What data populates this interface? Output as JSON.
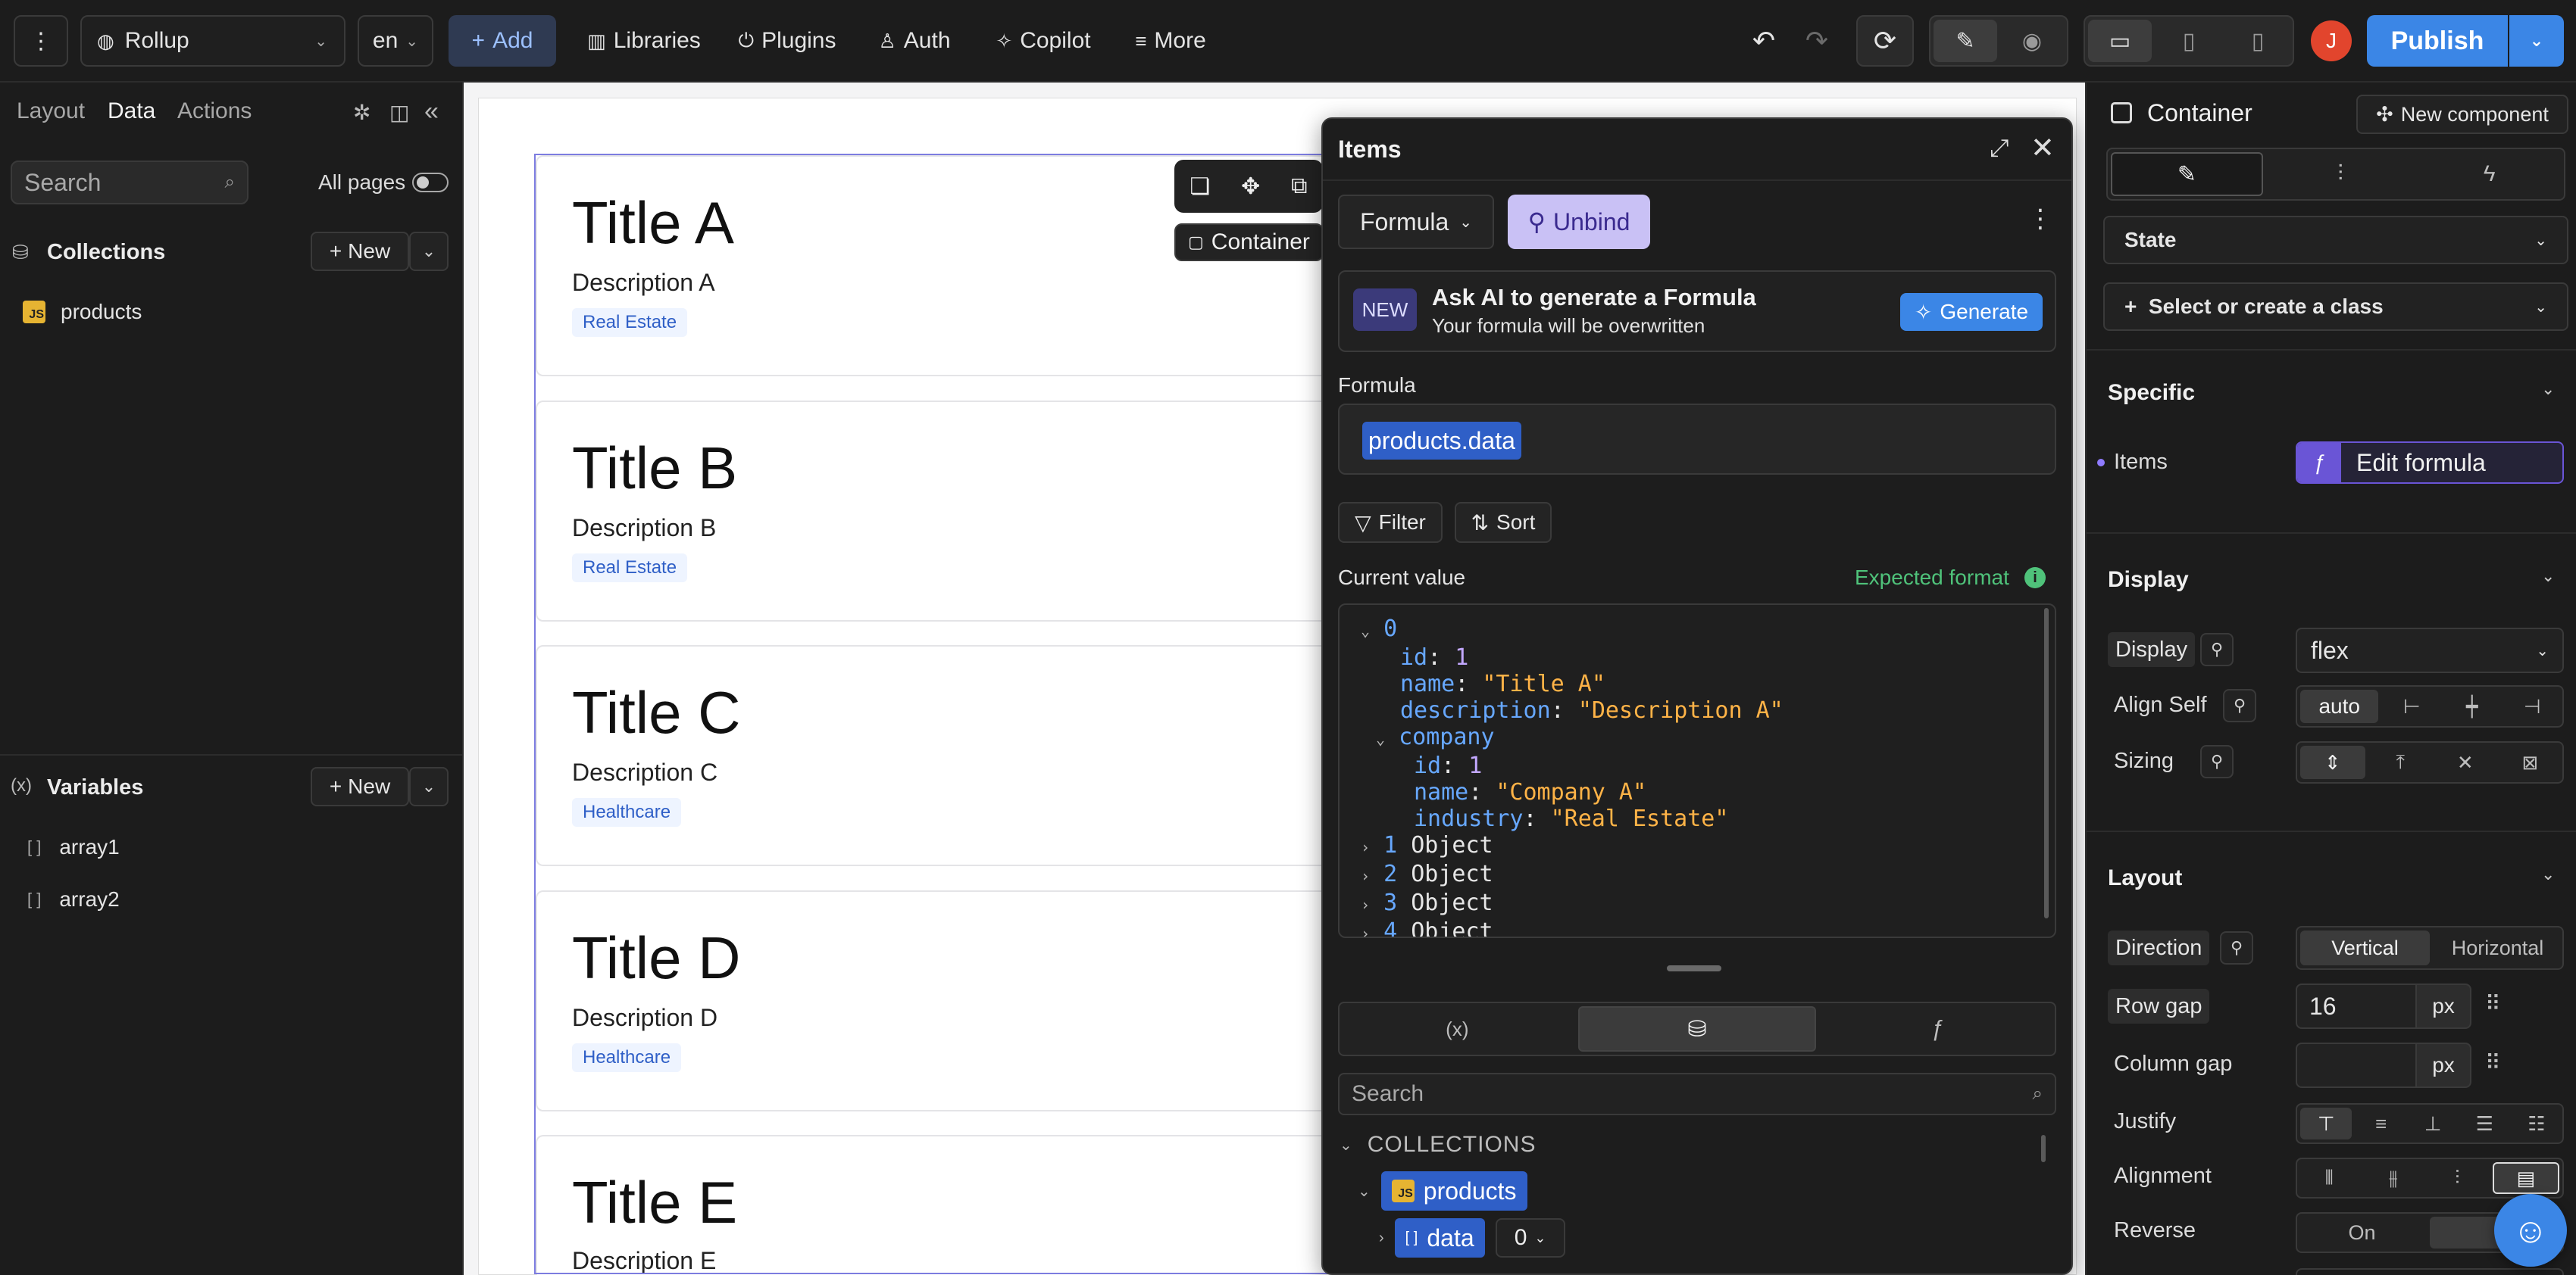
{
  "topbar": {
    "project": "Rollup",
    "language": "en",
    "add_label": "Add",
    "libraries_label": "Libraries",
    "plugins_label": "Plugins",
    "auth_label": "Auth",
    "copilot_label": "Copilot",
    "more_label": "More",
    "publish_label": "Publish",
    "avatar_initial": "J"
  },
  "left_panel": {
    "tabs": [
      "Layout",
      "Data",
      "Actions"
    ],
    "active_tab": "Data",
    "search_placeholder": "Search",
    "all_pages_label": "All pages",
    "collections_title": "Collections",
    "new_label": "New",
    "collections": [
      {
        "name": "products",
        "badge": "JS"
      }
    ],
    "variables_title": "Variables",
    "variables": [
      {
        "name": "array1"
      },
      {
        "name": "array2"
      }
    ]
  },
  "canvas": {
    "chip_label": "Container",
    "cards": [
      {
        "title": "Title A",
        "description": "Description A",
        "tag": "Real Estate"
      },
      {
        "title": "Title B",
        "description": "Description B",
        "tag": "Real Estate"
      },
      {
        "title": "Title C",
        "description": "Description C",
        "tag": "Healthcare"
      },
      {
        "title": "Title D",
        "description": "Description D",
        "tag": "Healthcare"
      },
      {
        "title": "Title E",
        "description": "Description E",
        "tag": ""
      }
    ]
  },
  "items_popup": {
    "title": "Items",
    "formula_dropdown": "Formula",
    "unbind_label": "Unbind",
    "ai_badge": "NEW",
    "ai_title": "Ask AI to generate a Formula",
    "ai_subtitle": "Your formula will be overwritten",
    "generate_label": "Generate",
    "formula_label": "Formula",
    "formula_value": "products.data",
    "filter_label": "Filter",
    "sort_label": "Sort",
    "current_value_label": "Current value",
    "expected_format_label": "Expected format",
    "tree": {
      "index0": "0",
      "id_key": "id",
      "id_val": "1",
      "name_key": "name",
      "name_val": "\"Title A\"",
      "desc_key": "description",
      "desc_val": "\"Description A\"",
      "company_key": "company",
      "c_id_key": "id",
      "c_id_val": "1",
      "c_name_key": "name",
      "c_name_val": "\"Company A\"",
      "c_ind_key": "industry",
      "c_ind_val": "\"Real Estate\"",
      "collapsed": [
        {
          "index": "1",
          "type": "Object"
        },
        {
          "index": "2",
          "type": "Object"
        },
        {
          "index": "3",
          "type": "Object"
        },
        {
          "index": "4",
          "type": "Object"
        }
      ]
    },
    "search_placeholder": "Search",
    "collections_header": "COLLECTIONS",
    "collection_item": "products",
    "data_item": "data",
    "data_index": "0"
  },
  "right_panel": {
    "component_label": "Container",
    "new_component_label": "New component",
    "state_label": "State",
    "class_label": "Select or create a class",
    "specific_title": "Specific",
    "items_label": "Items",
    "edit_formula_label": "Edit formula",
    "display_title": "Display",
    "display_label": "Display",
    "display_value": "flex",
    "align_self_label": "Align Self",
    "align_self_value": "auto",
    "sizing_label": "Sizing",
    "layout_title": "Layout",
    "direction_label": "Direction",
    "direction_options": [
      "Vertical",
      "Horizontal"
    ],
    "row_gap_label": "Row gap",
    "row_gap_value": "16",
    "row_gap_unit": "px",
    "column_gap_label": "Column gap",
    "column_gap_unit": "px",
    "justify_label": "Justify",
    "alignment_label": "Alignment",
    "reverse_label": "Reverse",
    "reverse_on": "On"
  },
  "colors": {
    "accent": "#3b86e6",
    "chrome": "#1c1c1c",
    "selection": "#7c7ce0"
  }
}
